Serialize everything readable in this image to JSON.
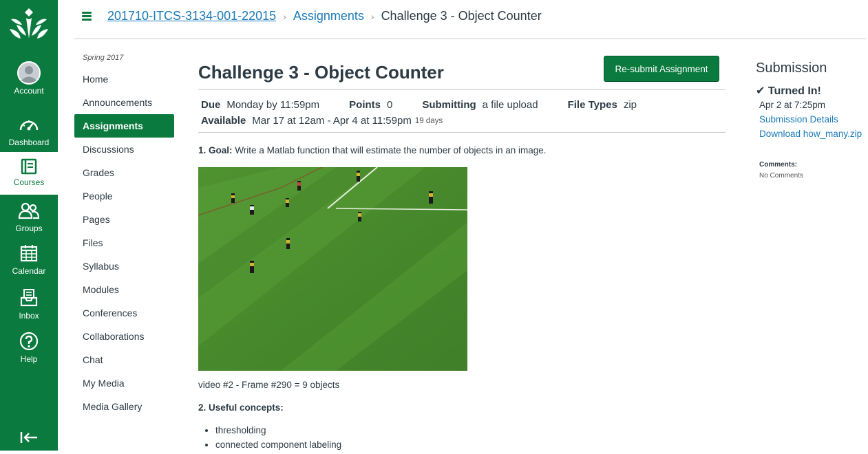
{
  "global_nav": {
    "items": [
      {
        "label": "Account",
        "icon": "account-avatar-icon"
      },
      {
        "label": "Dashboard",
        "icon": "dashboard-icon"
      },
      {
        "label": "Courses",
        "icon": "courses-icon"
      },
      {
        "label": "Groups",
        "icon": "groups-icon"
      },
      {
        "label": "Calendar",
        "icon": "calendar-icon"
      },
      {
        "label": "Inbox",
        "icon": "inbox-icon"
      },
      {
        "label": "Help",
        "icon": "help-icon"
      }
    ],
    "active": "Courses"
  },
  "breadcrumb": {
    "course": "201710-ITCS-3134-001-22015",
    "section": "Assignments",
    "current": "Challenge 3 - Object Counter"
  },
  "course_nav": {
    "term": "Spring 2017",
    "links": [
      "Home",
      "Announcements",
      "Assignments",
      "Discussions",
      "Grades",
      "People",
      "Pages",
      "Files",
      "Syllabus",
      "Modules",
      "Conferences",
      "Collaborations",
      "Chat",
      "My Media",
      "Media Gallery"
    ],
    "active": "Assignments"
  },
  "assignment": {
    "title": "Challenge 3 - Object Counter",
    "resubmit_label": "Re-submit Assignment",
    "due_label": "Due",
    "due_value": "Monday by 11:59pm",
    "points_label": "Points",
    "points_value": "0",
    "submitting_label": "Submitting",
    "submitting_value": "a file upload",
    "filetypes_label": "File Types",
    "filetypes_value": "zip",
    "available_label": "Available",
    "available_value": "Mar 17 at 12am - Apr 4 at 11:59pm",
    "available_days": "19 days",
    "goal_num": "1.",
    "goal_label": "Goal:",
    "goal_text": "Write a Matlab function that will estimate the number of objects in an image.",
    "image_caption": "video #2 - Frame #290 = 9 objects",
    "useful_num": "2.",
    "useful_label": "Useful concepts:",
    "concepts": [
      "thresholding",
      "connected component labeling"
    ]
  },
  "submission": {
    "heading": "Submission",
    "status": "Turned In!",
    "date": "Apr 2 at 7:25pm",
    "details_link": "Submission Details",
    "download_link": "Download how_many.zip",
    "comments_label": "Comments:",
    "comments_value": "No Comments"
  },
  "colors": {
    "brand": "#0a7a3e",
    "link": "#1c7ab8"
  }
}
